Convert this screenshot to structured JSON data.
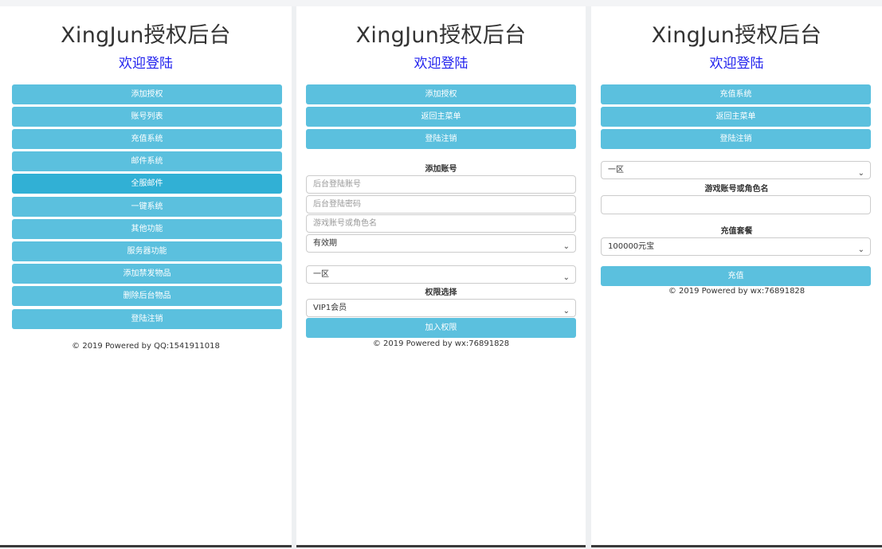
{
  "panel1": {
    "title": "XingJun授权后台",
    "subtitle": "欢迎登陆",
    "buttons": [
      "添加授权",
      "账号列表",
      "充值系统",
      "邮件系统",
      "全服邮件",
      "一键系统",
      "其他功能",
      "服务器功能",
      "添加禁发物品",
      "删除后台物品",
      "登陆注销"
    ],
    "footer": "© 2019 Powered by QQ:1541911018"
  },
  "panel2": {
    "title": "XingJun授权后台",
    "subtitle": "欢迎登陆",
    "buttons": [
      "添加授权",
      "返回主菜单",
      "登陆注销"
    ],
    "section_title": "添加账号",
    "inputs": {
      "admin_account_placeholder": "后台登陆账号",
      "admin_password_placeholder": "后台登陆密码",
      "game_account_placeholder": "游戏账号或角色名"
    },
    "validity_select": "有效期",
    "zone_select": "一区",
    "permission_title": "权限选择",
    "permission_select": "VIP1会员",
    "submit": "加入权限",
    "footer": "© 2019 Powered by wx:76891828"
  },
  "panel3": {
    "title": "XingJun授权后台",
    "subtitle": "欢迎登陆",
    "buttons": [
      "充值系统",
      "返回主菜单",
      "登陆注销"
    ],
    "zone_select": "一区",
    "account_label": "游戏账号或角色名",
    "account_value": "",
    "package_label": "充值套餐",
    "package_select": "100000元宝",
    "submit": "充值",
    "footer": "© 2019 Powered by wx:76891828"
  },
  "colors": {
    "button": "#5bc0de",
    "button_active": "#31b0d5",
    "subtitle": "#2222ee"
  },
  "icons": {
    "select_arrow": "chevron-down-icon"
  }
}
